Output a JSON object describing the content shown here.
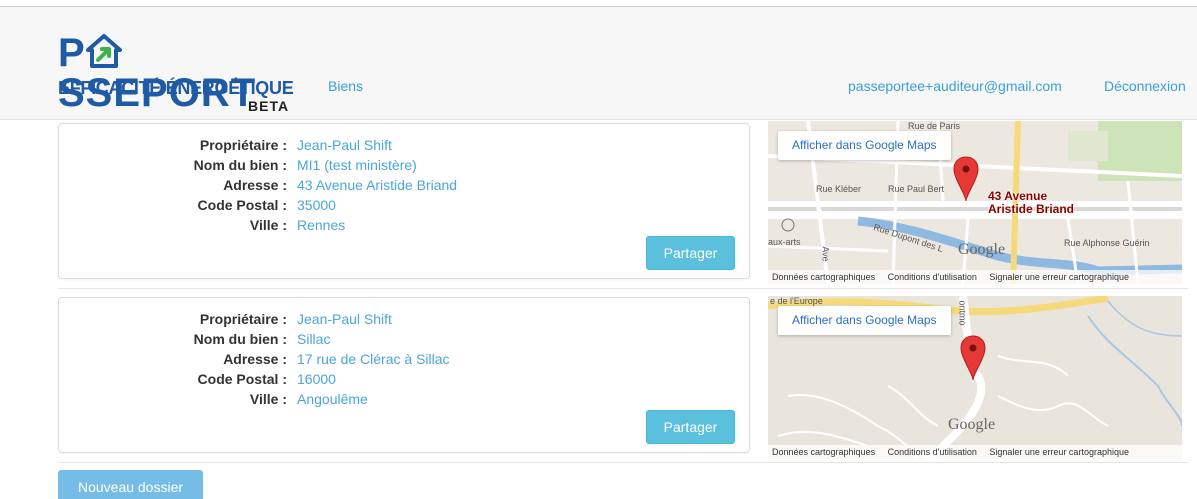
{
  "header": {
    "logo_main_prefix": "P",
    "logo_main_suffix": "SSEPORT",
    "logo_sub": "EFFICACITÉ ÉNERGÉTIQUE",
    "logo_beta": "BETA",
    "nav_biens": "Biens",
    "user_email": "passeportee+auditeur@gmail.com",
    "logout": "Déconnexion"
  },
  "labels": {
    "owner": "Propriétaire :",
    "property_name": "Nom du bien :",
    "address": "Adresse :",
    "postal_code": "Code Postal :",
    "city": "Ville :"
  },
  "share_label": "Partager",
  "map_link_label": "Afficher dans Google Maps",
  "map_footer": {
    "data": "Données cartographiques",
    "terms": "Conditions d'utilisation",
    "report": "Signaler une erreur cartographique"
  },
  "google_watermark": "Google",
  "properties": [
    {
      "owner": "Jean-Paul Shift",
      "name": "MI1 (test ministère)",
      "address": "43 Avenue Aristide Briand",
      "postal_code": "35000",
      "city": "Rennes",
      "map_marker_label_line1": "43 Avenue",
      "map_marker_label_line2": "Aristide Briand",
      "streets": [
        "Rue de Paris",
        "Rue Kléber",
        "Rue Paul Bert",
        "aux-arts",
        "Rue Dupont des L",
        "Rue Alphonse Guérin",
        "Ave"
      ]
    },
    {
      "owner": "Jean-Paul Shift",
      "name": "Sillac",
      "address": "17 rue de Clérac à Sillac",
      "postal_code": "16000",
      "city": "Angoulême",
      "streets": [
        "e de l'Europe",
        "ontmo"
      ]
    }
  ],
  "new_folder_label": "Nouveau dossier",
  "colors": {
    "brand_blue": "#1e5aa6",
    "link_blue": "#4aa6dc",
    "button_info": "#5bc0de",
    "marker_red": "#e53935"
  }
}
